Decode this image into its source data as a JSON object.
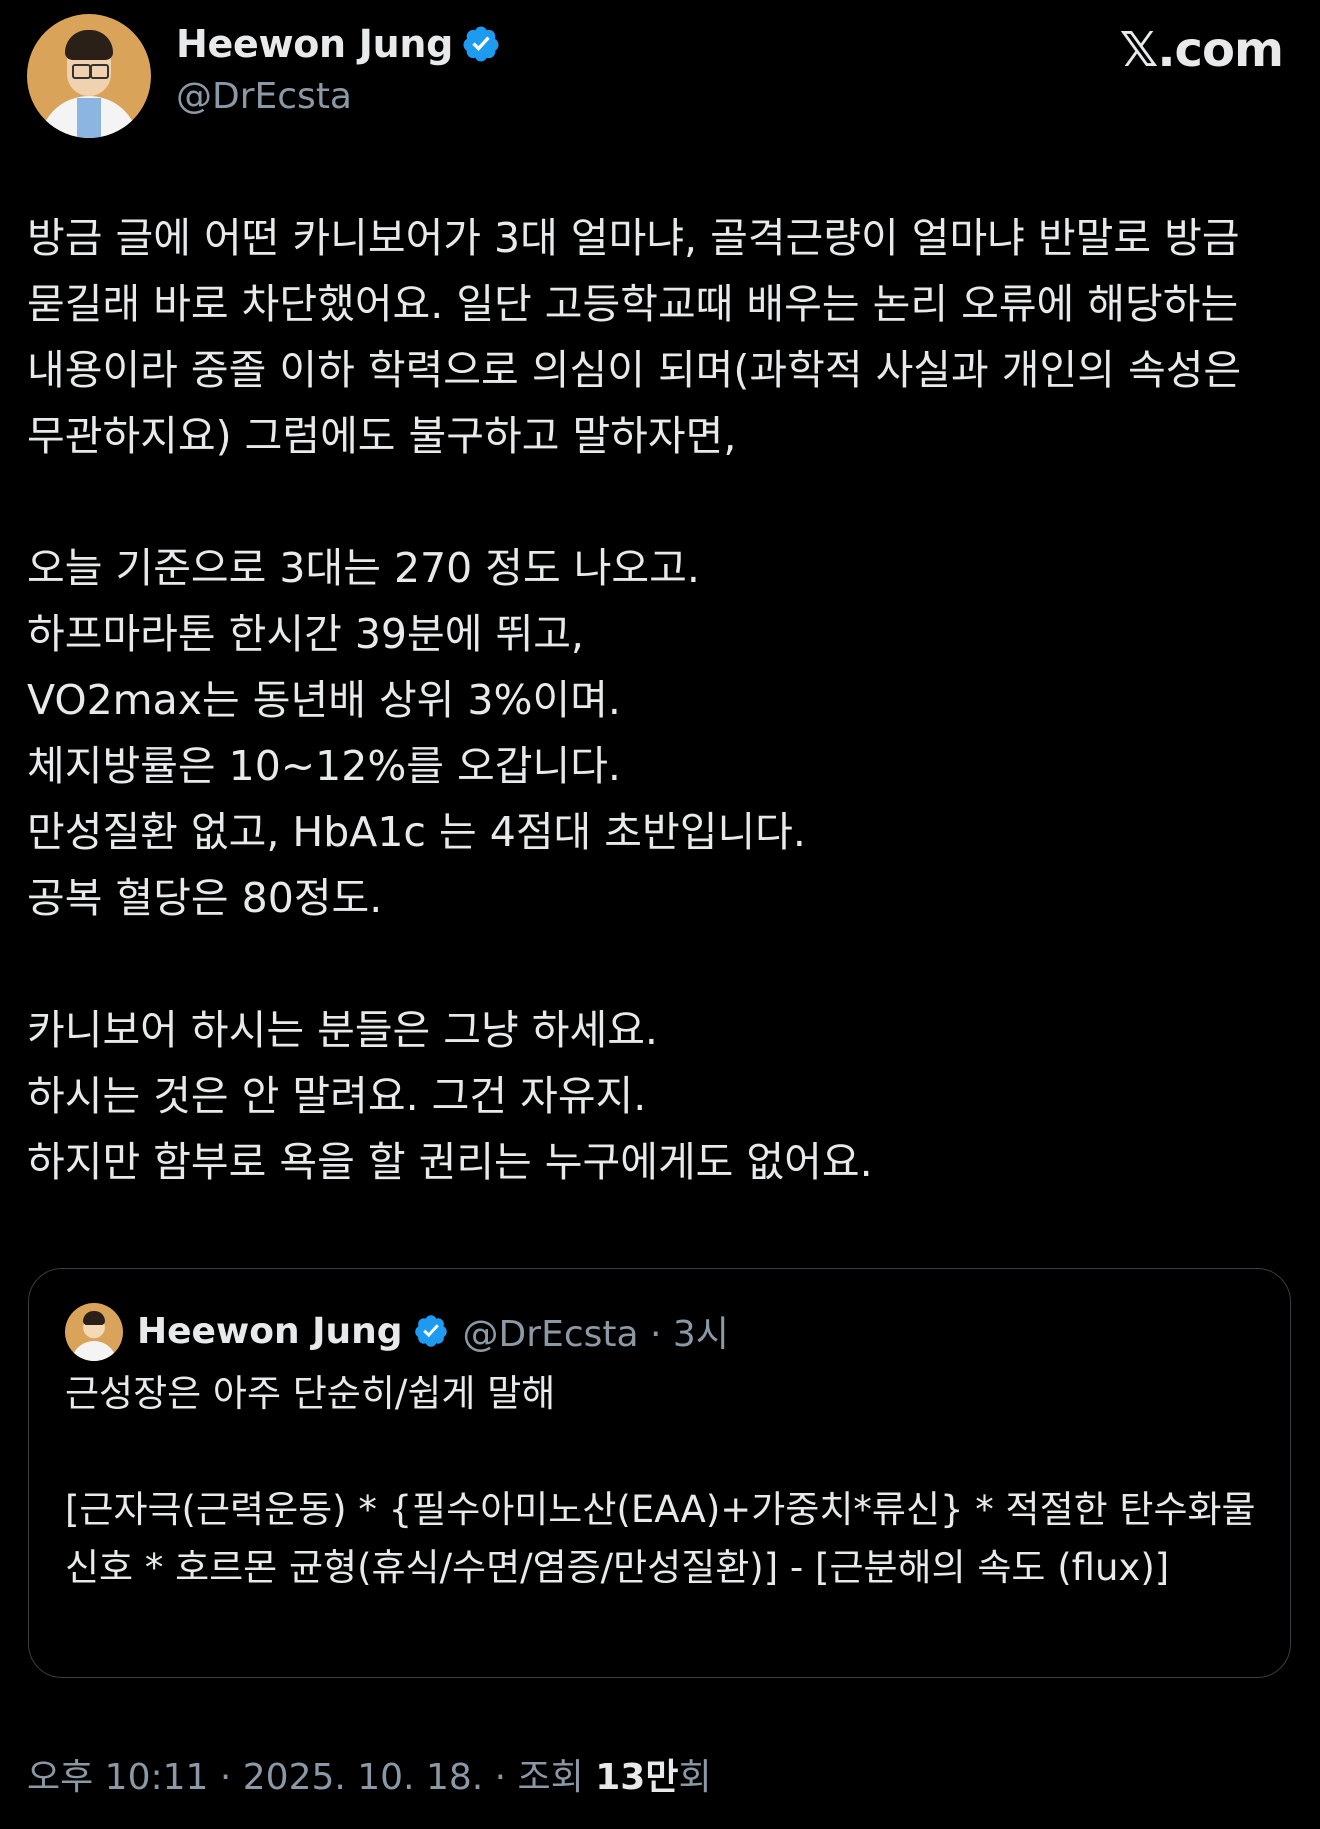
{
  "author": {
    "name": "Heewon Jung",
    "handle": "@DrEcsta",
    "verified_icon": "verified-badge-icon",
    "verified_color": "#1d9bf0"
  },
  "site_logo": "𝕏.com",
  "tweet": {
    "text": "방금 글에 어떤 카니보어가 3대 얼마냐, 골격근량이 얼마냐 반말로 방금 묻길래 바로 차단했어요. 일단 고등학교때 배우는 논리 오류에 해당하는 내용이라 중졸 이하 학력으로 의심이 되며(과학적 사실과 개인의 속성은 무관하지요) 그럼에도 불구하고 말하자면,\n\n오늘 기준으로 3대는 270 정도 나오고.\n하프마라톤 한시간 39분에 뛰고,\nVO2max는 동년배 상위 3%이며.\n체지방률은 10~12%를 오갑니다.\n만성질환 없고, HbA1c 는 4점대 초반입니다.\n공복 혈당은 80정도.\n\n카니보어 하시는 분들은 그냥 하세요.\n하시는 것은 안 말려요. 그건 자유지.\n하지만 함부로 욕을 할 권리는 누구에게도 없어요."
  },
  "quoted_tweet": {
    "name": "Heewon Jung",
    "meta": "@DrEcsta · 3시",
    "text": "근성장은 아주 단순히/쉽게 말해\n\n[근자극(근력운동) * {필수아미노산(EAA)+가중치*류신} * 적절한 탄수화물 신호 * 호르몬 균형(휴식/수면/염증/만성질환)] - [근분해의 속도 (flux)]"
  },
  "footer": {
    "time_date": "오후 10:11 · 2025. 10. 18. · 조회 ",
    "views": "13만",
    "views_suffix": "회"
  },
  "colors": {
    "background": "#000000",
    "text": "#e7e9ea",
    "secondary": "#8b98a5",
    "border": "#3a3f44"
  }
}
